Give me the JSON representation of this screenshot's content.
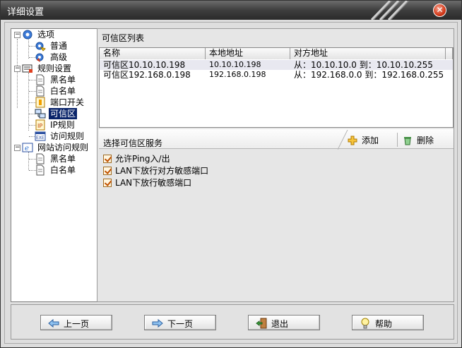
{
  "window": {
    "title": "详细设置"
  },
  "tree": {
    "options": "选项",
    "general": "普通",
    "advanced": "高级",
    "rules": "规则设置",
    "blacklist": "黑名单",
    "whitelist": "白名单",
    "port_switch": "端口开关",
    "trusted_zone": "可信区",
    "ip_rules": "IP规则",
    "access_rules": "访问规则",
    "web_rules": "网站访问规则",
    "web_blacklist": "黑名单",
    "web_whitelist": "白名单"
  },
  "trusted_list": {
    "title": "可信区列表",
    "columns": [
      "名称",
      "本地地址",
      "对方地址"
    ],
    "rows": [
      {
        "name": "可信区10.10.10.198",
        "local": "10.10.10.198",
        "remote": "从：10.10.10.0 到：10.10.10.255"
      },
      {
        "name": "可信区192.168.0.198",
        "local": "192.168.0.198",
        "remote": "从：192.168.0.0 到：192.168.0.255"
      }
    ]
  },
  "services": {
    "title": "选择可信区服务",
    "add": "添加",
    "delete": "删除",
    "items": [
      "允许Ping入/出",
      "LAN下放行对方敏感端口",
      "LAN下放行敏感端口"
    ]
  },
  "buttons": {
    "prev": "上一页",
    "next": "下一页",
    "exit": "退出",
    "help": "帮助"
  },
  "colors": {
    "selection": "#0a246a",
    "titlebar": "#3e3e3e",
    "close": "#d2391a"
  }
}
